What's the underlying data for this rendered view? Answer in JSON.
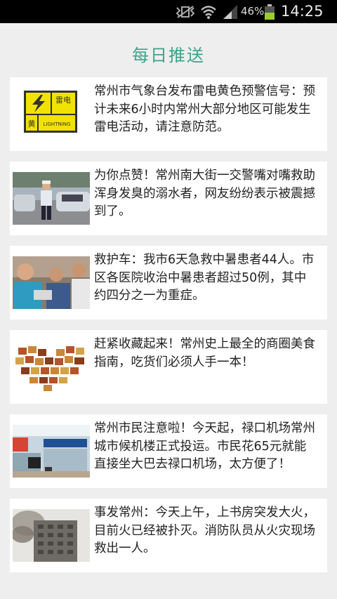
{
  "status_bar": {
    "battery_percent": "46%",
    "time": "14:25",
    "icons": [
      "mute-vibrate-icon",
      "wifi-icon",
      "signal-icon",
      "battery-icon"
    ]
  },
  "header": {
    "title": "每日推送"
  },
  "feed": {
    "items": [
      {
        "text": "常州市气象台发布雷电黄色预警信号：预计未来6小时内常州大部分地区可能发生雷电活动，请注意防范。",
        "image": "lightning-warning-sign",
        "badge_top": "雷电",
        "badge_mid": "黄",
        "badge_bottom": "LIGHTNING"
      },
      {
        "text": "为你点赞！常州南大街一交警嘴对嘴救助浑身发臭的溺水者，网友纷纷表示被震撼到了。",
        "image": "traffic-police-street"
      },
      {
        "text": "救护车：我市6天急救中暑患者44人。市区各医院收治中暑患者超过50例，其中约四分之一为重症。",
        "image": "rescue-people"
      },
      {
        "text": "赶紧收藏起来！常州史上最全的商圈美食指南，吃货们必须人手一本！",
        "image": "food-heart-collage"
      },
      {
        "text": "常州市民注意啦！今天起，禄口机场常州城市候机楼正式投运。市民花65元就能直接坐大巴去禄口机场，太方便了！",
        "image": "city-airport-terminal"
      },
      {
        "text": "事发常州：今天上午，上书房突发大火，目前火已经被扑灭。消防队员从火灾现场救出一人。",
        "image": "building-fire-smoke"
      }
    ]
  }
}
